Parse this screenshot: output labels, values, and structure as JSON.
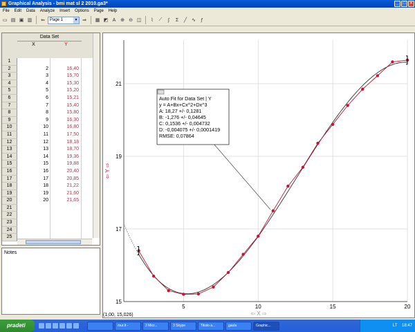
{
  "window": {
    "title": "Graphical Analysis - bmi mat sl 2 2010.ga3*"
  },
  "menu": [
    "File",
    "Edit",
    "Data",
    "Analyze",
    "Insert",
    "Options",
    "Page",
    "Help"
  ],
  "toolbar": {
    "page_selector": "Page 1"
  },
  "table": {
    "set_name": "Data Set",
    "x_header": "X",
    "y_header": "Y",
    "row_numbers": [
      "1",
      "2",
      "3",
      "4",
      "5",
      "6",
      "7",
      "8",
      "9",
      "10",
      "11",
      "12",
      "13",
      "14",
      "15",
      "16",
      "17",
      "18",
      "19",
      "20",
      "21",
      "22",
      "23",
      "24",
      "25"
    ],
    "x_values": [
      "",
      "2",
      "3",
      "4",
      "5",
      "6",
      "7",
      "8",
      "9",
      "10",
      "11",
      "12",
      "13",
      "14",
      "15",
      "16",
      "17",
      "18",
      "19",
      "20",
      "",
      "",
      "",
      "",
      ""
    ],
    "y_values": [
      "",
      "16,40",
      "15,70",
      "15,30",
      "15,20",
      "15,21",
      "15,40",
      "15,80",
      "16,30",
      "16,80",
      "17,50",
      "18,18",
      "18,70",
      "19,36",
      "19,88",
      "20,40",
      "20,85",
      "21,22",
      "21,60",
      "21,65",
      "",
      "",
      "",
      "",
      ""
    ]
  },
  "notes": {
    "label": "Notes"
  },
  "fit_box": {
    "title": "Auto Fit for  Data Set | Y",
    "equation": "y = A+Bx+Cx^2+Dx^3",
    "a": "A: 18,27 +/- 0,1281",
    "b": "B: -1,276 +/- 0,04645",
    "c": "C: 0,1536 +/- 0,004732",
    "d": "D: -0,004075 +/- 0,0001419",
    "rmse": "RMSE: 0,07864"
  },
  "coord_readout": "(1,00, 15,026)",
  "chart_data": {
    "type": "scatter",
    "x": [
      2,
      3,
      4,
      5,
      6,
      7,
      8,
      9,
      10,
      11,
      12,
      13,
      14,
      15,
      16,
      17,
      18,
      19,
      20
    ],
    "y": [
      16.4,
      15.7,
      15.3,
      15.2,
      15.21,
      15.4,
      15.8,
      16.3,
      16.8,
      17.5,
      18.18,
      18.7,
      19.36,
      19.88,
      20.4,
      20.85,
      21.22,
      21.6,
      21.65
    ],
    "fit": {
      "A": 18.27,
      "B": -1.276,
      "C": 0.1536,
      "D": -0.004075
    },
    "xlim": [
      1,
      20
    ],
    "ylim": [
      15,
      22.2
    ],
    "x_ticks": [
      "5",
      "10",
      "15",
      "20"
    ],
    "y_ticks": [
      "15",
      "17",
      "19",
      "21"
    ],
    "xlabel": "X",
    "ylabel": "Y",
    "grid": true,
    "colors": {
      "points": "#cc1133",
      "line": "#cc1133",
      "fit": "#333333"
    }
  },
  "taskbar": {
    "start_label": "pradeti",
    "tasks": [
      "",
      "mur.lt -",
      "2 Micr...",
      "3 Skype",
      "Tikslo a...",
      "gaula",
      "Graphic..."
    ],
    "tray_text": "LT",
    "clock": "18:47"
  }
}
